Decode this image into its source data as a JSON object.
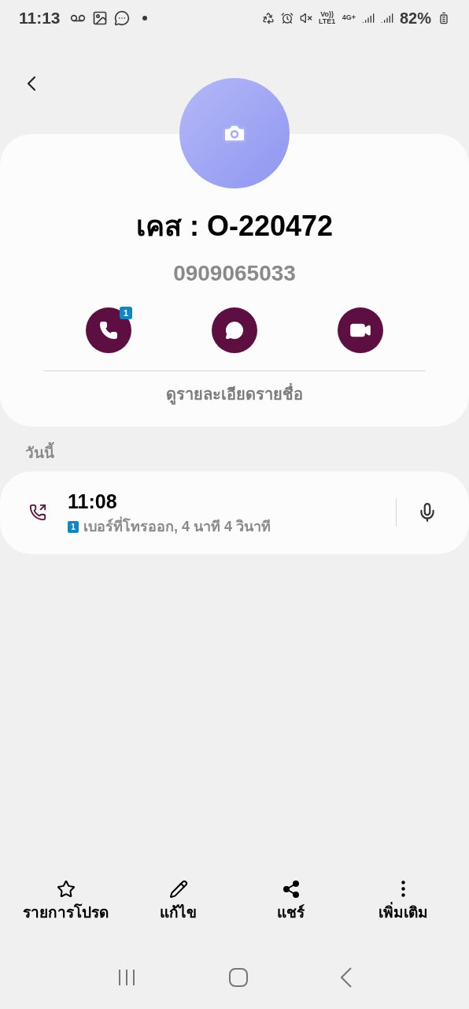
{
  "status_bar": {
    "time": "11:13",
    "volte": "Vo)) LTE1",
    "network": "4G+",
    "battery": "82%"
  },
  "contact": {
    "name": "เคส : O-220472",
    "number": "0909065033",
    "view_details": "ดูรายละเอียดรายชื่อ"
  },
  "actions": [
    {
      "kind": "call",
      "badge": "1"
    },
    {
      "kind": "message"
    },
    {
      "kind": "video"
    }
  ],
  "section": "วันนี้",
  "calls": [
    {
      "time": "11:08",
      "sim": "1",
      "detail": "เบอร์ที่โทรออก, 4 นาที 4 วินาที"
    }
  ],
  "bottom_bar": [
    {
      "kind": "star",
      "label": "รายการโปรด"
    },
    {
      "kind": "edit",
      "label": "แก้ไข"
    },
    {
      "kind": "share",
      "label": "แชร์"
    },
    {
      "kind": "more",
      "label": "เพิ่มเติม"
    }
  ]
}
